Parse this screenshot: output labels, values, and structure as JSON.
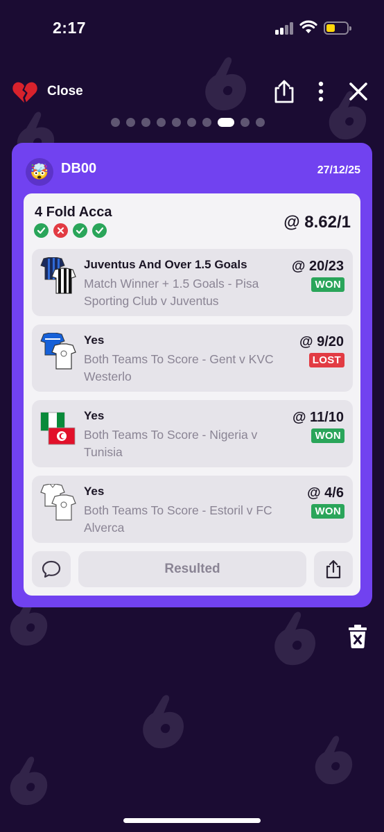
{
  "status_bar": {
    "time": "2:17"
  },
  "top_bar": {
    "close_label": "Close",
    "icons": [
      "broken-heart-icon",
      "share-icon",
      "more-icon",
      "close-icon"
    ]
  },
  "pager": {
    "count": 10,
    "active_index": 7
  },
  "card": {
    "username": "DB00",
    "avatar_emoji": "🤯",
    "date": "27/12/25",
    "bet_title": "4 Fold Acca",
    "bet_odds": "@ 8.62/1",
    "leg_results": [
      "won",
      "lost",
      "won",
      "won"
    ],
    "legs": [
      {
        "selection": "Juventus And Over 1.5 Goals",
        "description": "Match Winner + 1.5 Goals - Pisa Sporting Club v Juventus",
        "odds": "@ 20/23",
        "result": "WON",
        "icon": "pisa-juventus-shirts-icon"
      },
      {
        "selection": "Yes",
        "description": "Both Teams To Score - Gent v KVC Westerlo",
        "odds": "@ 9/20",
        "result": "LOST",
        "icon": "gent-westerlo-shirts-icon"
      },
      {
        "selection": "Yes",
        "description": "Both Teams To Score - Nigeria v Tunisia",
        "odds": "@ 11/10",
        "result": "WON",
        "icon": "nigeria-tunisia-flags-icon"
      },
      {
        "selection": "Yes",
        "description": "Both Teams To Score - Estoril v FC Alverca",
        "odds": "@ 4/6",
        "result": "WON",
        "icon": "estoril-alverca-shirts-icon"
      }
    ],
    "footer": {
      "status_label": "Resulted"
    }
  },
  "colors": {
    "background": "#1b0c33",
    "card": "#7142f0",
    "won": "#2aa55a",
    "lost": "#e23b43"
  }
}
